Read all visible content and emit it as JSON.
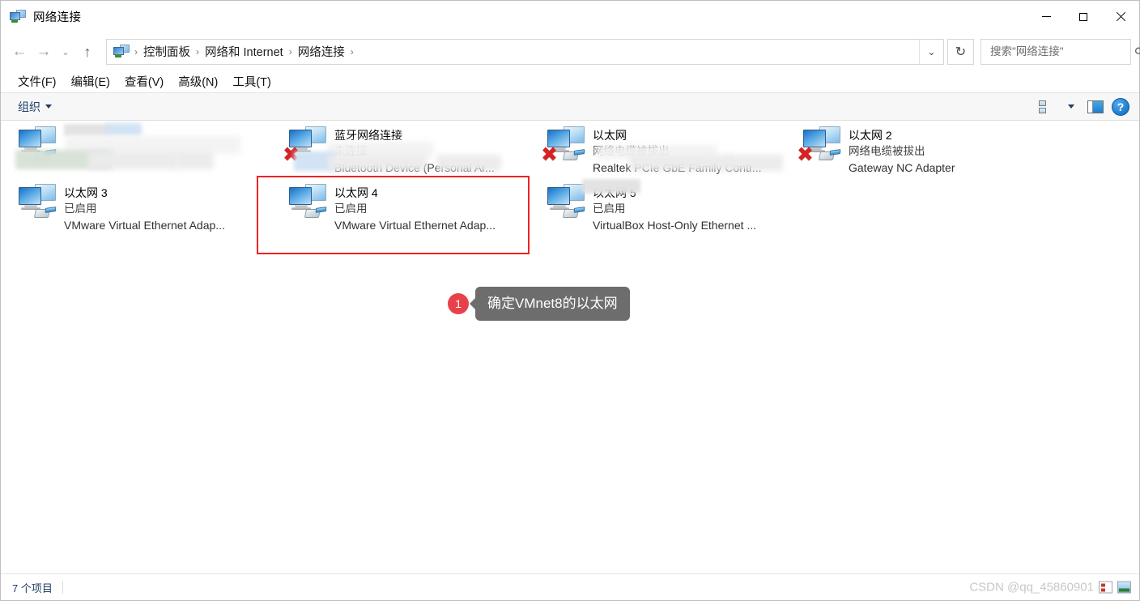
{
  "window": {
    "title": "网络连接",
    "icon": "network-connections-icon",
    "controls": {
      "minimize": "minimize-icon",
      "maximize": "maximize-icon",
      "close": "close-icon"
    }
  },
  "navigation": {
    "back": "←",
    "forward": "→",
    "recent": "⌄",
    "up": "↑",
    "breadcrumbs": [
      "控制面板",
      "网络和 Internet",
      "网络连接"
    ],
    "separator": "›",
    "dropdown": "⌄",
    "refresh": "↻"
  },
  "search": {
    "placeholder": "搜索\"网络连接\"",
    "value": "",
    "icon": "search-icon"
  },
  "menubar": {
    "items": [
      "文件(F)",
      "编辑(E)",
      "查看(V)",
      "高级(N)",
      "工具(T)"
    ]
  },
  "commandbar": {
    "organize_label": "组织",
    "view_options_icon": "view-options-icon",
    "view_dropdown_icon": "chevron-down-icon",
    "preview_pane_icon": "preview-pane-icon",
    "help_icon": "?",
    "help_label": "帮助"
  },
  "connections": [
    {
      "name": "",
      "status": "",
      "device": "",
      "icon": "network-adapter-icon",
      "disconnected": false,
      "redacted": true,
      "highlighted": false
    },
    {
      "name": "蓝牙网络连接",
      "status": "未连接",
      "device": "Bluetooth Device (Personal Ar...",
      "icon": "bluetooth-adapter-icon",
      "disconnected": true,
      "redacted": true,
      "highlighted": false
    },
    {
      "name": "以太网",
      "status": "网络电缆被拔出",
      "device": "Realtek PCIe GbE Family Contr...",
      "icon": "network-adapter-icon",
      "disconnected": true,
      "redacted": true,
      "highlighted": false
    },
    {
      "name": "以太网 2",
      "status": "网络电缆被拔出",
      "device": "Gateway NC Adapter",
      "icon": "network-adapter-icon",
      "disconnected": true,
      "redacted": false,
      "highlighted": false
    },
    {
      "name": "以太网 3",
      "status": "已启用",
      "device": "VMware Virtual Ethernet Adap...",
      "icon": "network-adapter-icon",
      "disconnected": false,
      "redacted": false,
      "highlighted": false
    },
    {
      "name": "以太网 4",
      "status": "已启用",
      "device": "VMware Virtual Ethernet Adap...",
      "icon": "network-adapter-icon",
      "disconnected": false,
      "redacted": false,
      "highlighted": true
    },
    {
      "name": "以太网 5",
      "status": "已启用",
      "device": "VirtualBox Host-Only Ethernet ...",
      "icon": "network-adapter-icon",
      "disconnected": false,
      "redacted": true,
      "highlighted": false
    }
  ],
  "annotation": {
    "badge": "1",
    "text": "确定VMnet8的以太网"
  },
  "statusbar": {
    "item_count": "7 个项目",
    "watermark": "CSDN @qq_45860901",
    "view_tiles_icon": "tiles-view-icon",
    "view_details_icon": "details-view-icon"
  },
  "colors": {
    "accent_red": "#f02222",
    "badge_red": "#e8414a",
    "bubble_gray": "#6d6d6d",
    "link_blue": "#1f3f66"
  }
}
